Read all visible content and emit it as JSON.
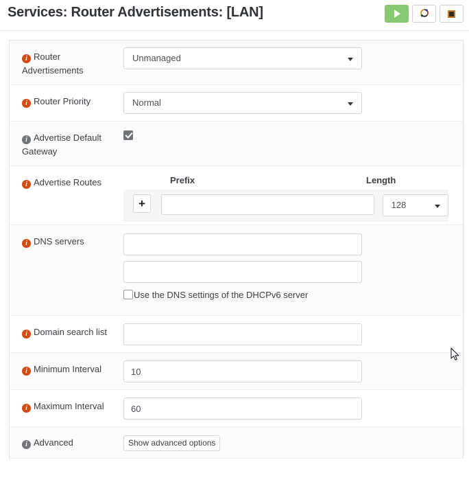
{
  "header": {
    "title": "Services: Router Advertisements: [LAN]",
    "buttons": [
      {
        "name": "start",
        "icon": "play-icon",
        "label": ""
      },
      {
        "name": "restart",
        "icon": "refresh-icon",
        "label": ""
      },
      {
        "name": "stop",
        "icon": "stop-icon",
        "label": ""
      }
    ],
    "colors": {
      "start_bg": "#86cb72",
      "stop_accent": "#d4761a",
      "info_icon": "#d9480f"
    }
  },
  "form": {
    "rows": [
      {
        "name": "router-advertisements",
        "label": "Router Advertisements",
        "info_color": "orange",
        "control": "select",
        "value": "Unmanaged"
      },
      {
        "name": "router-priority",
        "label": "Router Priority",
        "info_color": "orange",
        "control": "select",
        "value": "Normal"
      },
      {
        "name": "advertise-default-gateway",
        "label": "Advertise Default Gateway",
        "info_color": "gray",
        "control": "checkbox",
        "checked": true
      },
      {
        "name": "advertise-routes",
        "label": "Advertise Routes",
        "info_color": "orange",
        "control": "routes-table",
        "columns": {
          "prefix": "Prefix",
          "length": "Length"
        },
        "add_label": "+",
        "prefix_value": "",
        "length_value": "128"
      },
      {
        "name": "dns-servers",
        "label": "DNS servers",
        "info_color": "orange",
        "control": "dns",
        "server1": "",
        "server2": "",
        "dhcpv6_label": "Use the DNS settings of the DHCPv6 server",
        "dhcpv6_checked": false
      },
      {
        "name": "domain-search-list",
        "label": "Domain search list",
        "info_color": "orange",
        "control": "text",
        "value": ""
      },
      {
        "name": "minimum-interval",
        "label": "Minimum Interval",
        "info_color": "orange",
        "control": "text",
        "value": "10"
      },
      {
        "name": "maximum-interval",
        "label": "Maximum Interval",
        "info_color": "orange",
        "control": "text",
        "value": "60"
      },
      {
        "name": "advanced",
        "label": "Advanced",
        "info_color": "gray",
        "control": "button",
        "value": "Show advanced options"
      }
    ]
  },
  "info_glyph": "i"
}
